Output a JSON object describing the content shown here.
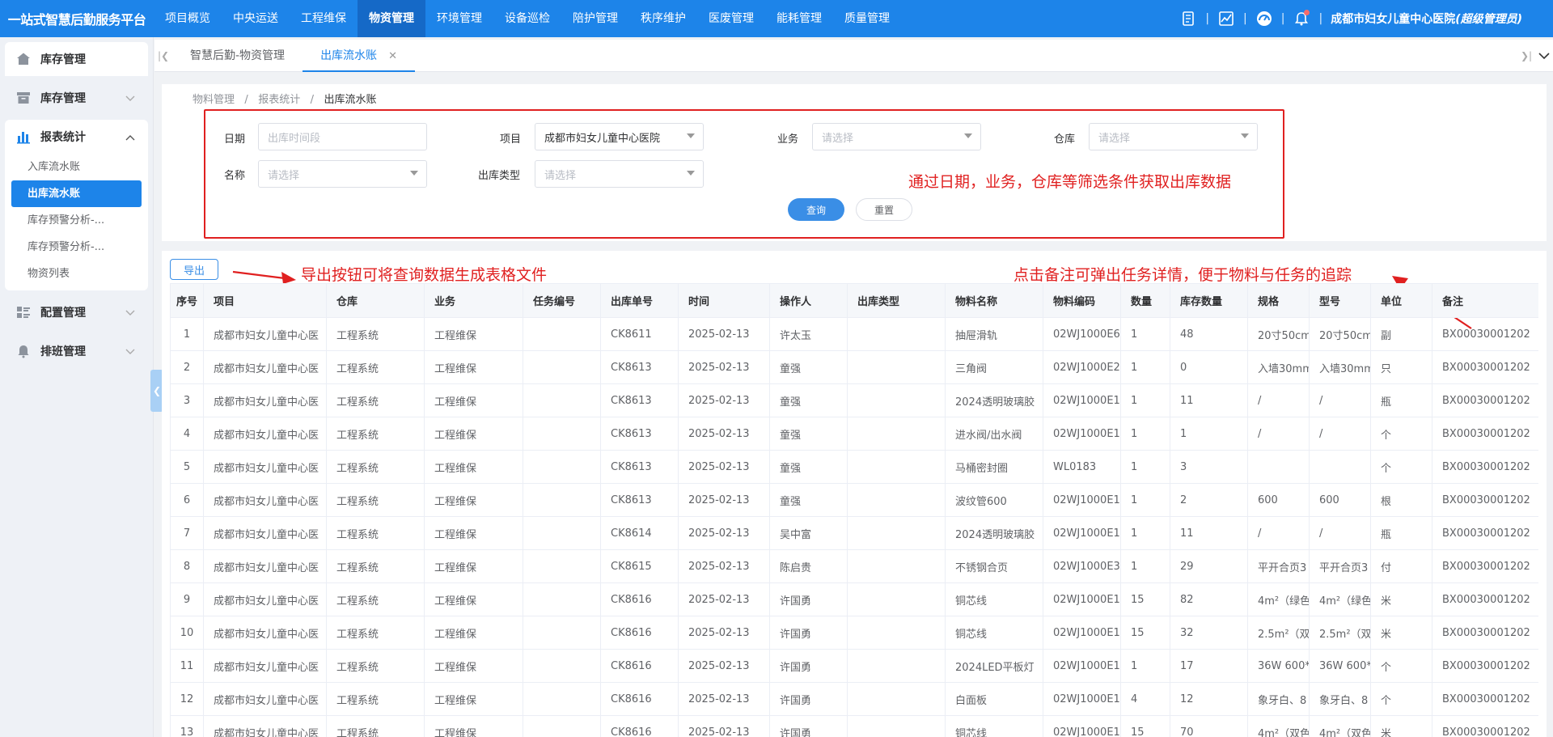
{
  "header": {
    "brand": "一站式智慧后勤服务平台",
    "nav": [
      "项目概览",
      "中央运送",
      "工程维保",
      "物资管理",
      "环境管理",
      "设备巡检",
      "陪护管理",
      "秩序维护",
      "医废管理",
      "能耗管理",
      "质量管理"
    ],
    "active_nav": "物资管理",
    "user_org": "成都市妇女儿童中心医院",
    "user_role": "(超级管理员)",
    "icons": [
      "book-icon",
      "chart-icon",
      "dashboard-icon",
      "bell-icon"
    ]
  },
  "sidebar": {
    "groups": [
      {
        "label": "库存管理",
        "icon": "home-icon"
      },
      {
        "label": "库存管理",
        "icon": "box-icon"
      },
      {
        "label": "报表统计",
        "icon": "bar-chart-icon"
      },
      {
        "label": "配置管理",
        "icon": "grid-icon"
      },
      {
        "label": "排班管理",
        "icon": "bell-icon"
      }
    ],
    "subitems": [
      "入库流水账",
      "出库流水账",
      "库存预警分析-...",
      "库存预警分析-...",
      "物资列表"
    ]
  },
  "tabs": [
    "智慧后勤-物资管理",
    "出库流水账"
  ],
  "breadcrumb": [
    "物料管理",
    "报表统计",
    "出库流水账"
  ],
  "filters": {
    "date_label": "日期",
    "date_placeholder": "出库时间段",
    "project_label": "项目",
    "project_value": "成都市妇女儿童中心医院",
    "business_label": "业务",
    "business_placeholder": "请选择",
    "warehouse_label": "仓库",
    "warehouse_placeholder": "请选择",
    "name_label": "名称",
    "name_placeholder": "请选择",
    "outtype_label": "出库类型",
    "outtype_placeholder": "请选择",
    "query": "查询",
    "reset": "重置"
  },
  "annotations": {
    "filter_note": "通过日期，业务，仓库等筛选条件获取出库数据",
    "export_note": "导出按钮可将查询数据生成表格文件",
    "remark_note": "点击备注可弹出任务详情，便于物料与任务的追踪"
  },
  "export_label": "导出",
  "table": {
    "headers": [
      "序号",
      "项目",
      "仓库",
      "业务",
      "任务编号",
      "出库单号",
      "时间",
      "操作人",
      "出库类型",
      "物料名称",
      "物料编码",
      "数量",
      "库存数量",
      "规格",
      "型号",
      "单位",
      "备注"
    ],
    "rows": [
      [
        "1",
        "成都市妇女儿童中心医",
        "工程系统",
        "工程维保",
        "",
        "CK8611",
        "2025-02-13",
        "许太玉",
        "",
        "抽屉滑轨",
        "02WJ1000E6",
        "1",
        "48",
        "20寸50cm",
        "20寸50cm",
        "副",
        "BX00030001202"
      ],
      [
        "2",
        "成都市妇女儿童中心医",
        "工程系统",
        "工程维保",
        "",
        "CK8613",
        "2025-02-13",
        "童强",
        "",
        "三角阀",
        "02WJ1000E2",
        "1",
        "0",
        "入墙30mm",
        "入墙30mm",
        "只",
        "BX00030001202"
      ],
      [
        "3",
        "成都市妇女儿童中心医",
        "工程系统",
        "工程维保",
        "",
        "CK8613",
        "2025-02-13",
        "童强",
        "",
        "2024透明玻璃胶",
        "02WJ1000E1",
        "1",
        "11",
        "/",
        "/",
        "瓶",
        "BX00030001202"
      ],
      [
        "4",
        "成都市妇女儿童中心医",
        "工程系统",
        "工程维保",
        "",
        "CK8613",
        "2025-02-13",
        "童强",
        "",
        "进水阀/出水阀",
        "02WJ1000E1",
        "1",
        "1",
        "/",
        "/",
        "个",
        "BX00030001202"
      ],
      [
        "5",
        "成都市妇女儿童中心医",
        "工程系统",
        "工程维保",
        "",
        "CK8613",
        "2025-02-13",
        "童强",
        "",
        "马桶密封圈",
        "WL0183",
        "1",
        "3",
        "",
        "",
        "个",
        "BX00030001202"
      ],
      [
        "6",
        "成都市妇女儿童中心医",
        "工程系统",
        "工程维保",
        "",
        "CK8613",
        "2025-02-13",
        "童强",
        "",
        "波纹管600",
        "02WJ1000E1",
        "1",
        "2",
        "600",
        "600",
        "根",
        "BX00030001202"
      ],
      [
        "7",
        "成都市妇女儿童中心医",
        "工程系统",
        "工程维保",
        "",
        "CK8614",
        "2025-02-13",
        "吴中富",
        "",
        "2024透明玻璃胶",
        "02WJ1000E1",
        "1",
        "11",
        "/",
        "/",
        "瓶",
        "BX00030001202"
      ],
      [
        "8",
        "成都市妇女儿童中心医",
        "工程系统",
        "工程维保",
        "",
        "CK8615",
        "2025-02-13",
        "陈启贵",
        "",
        "不锈钢合页",
        "02WJ1000E3",
        "1",
        "29",
        "平开合页3",
        "平开合页3",
        "付",
        "BX00030001202"
      ],
      [
        "9",
        "成都市妇女儿童中心医",
        "工程系统",
        "工程维保",
        "",
        "CK8616",
        "2025-02-13",
        "许国勇",
        "",
        "铜芯线",
        "02WJ1000E1",
        "15",
        "82",
        "4m²（绿色",
        "4m²（绿色",
        "米",
        "BX00030001202"
      ],
      [
        "10",
        "成都市妇女儿童中心医",
        "工程系统",
        "工程维保",
        "",
        "CK8616",
        "2025-02-13",
        "许国勇",
        "",
        "铜芯线",
        "02WJ1000E1",
        "15",
        "32",
        "2.5m²（双",
        "2.5m²（双",
        "米",
        "BX00030001202"
      ],
      [
        "11",
        "成都市妇女儿童中心医",
        "工程系统",
        "工程维保",
        "",
        "CK8616",
        "2025-02-13",
        "许国勇",
        "",
        "2024LED平板灯",
        "02WJ1000E1",
        "1",
        "17",
        "36W 600*",
        "36W 600*",
        "个",
        "BX00030001202"
      ],
      [
        "12",
        "成都市妇女儿童中心医",
        "工程系统",
        "工程维保",
        "",
        "CK8616",
        "2025-02-13",
        "许国勇",
        "",
        "白面板",
        "02WJ1000E1",
        "4",
        "12",
        "象牙白、8",
        "象牙白、8",
        "个",
        "BX00030001202"
      ],
      [
        "13",
        "成都市妇女儿童中心医",
        "工程系统",
        "工程维保",
        "",
        "CK8616",
        "2025-02-13",
        "许国勇",
        "",
        "铜芯线",
        "02WJ1000E1",
        "15",
        "70",
        "4m²（双色",
        "4m²（双色",
        "米",
        "BX00030001202"
      ]
    ]
  },
  "colors": {
    "primary": "#1d84e9",
    "annotation": "#e02020",
    "sidebar_bg": "#eef1f6"
  }
}
